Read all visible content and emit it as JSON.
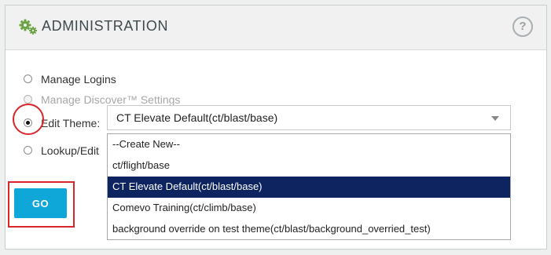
{
  "header": {
    "title": "ADMINISTRATION",
    "icon": "gears-icon",
    "help_label": "?"
  },
  "options": [
    {
      "label": "Manage Logins",
      "checked": false,
      "disabled": false
    },
    {
      "label": "Manage Discover™ Settings",
      "checked": false,
      "disabled": true
    },
    {
      "label": "Edit Theme:",
      "checked": true,
      "disabled": false
    },
    {
      "label": "Lookup/Edit",
      "checked": false,
      "disabled": false
    }
  ],
  "theme_select": {
    "selected": "CT Elevate Default(ct/blast/base)",
    "options": [
      "--Create New--",
      "ct/flight/base",
      "CT Elevate Default(ct/blast/base)",
      "Comevo Training(ct/climb/base)",
      "background override on test theme(ct/blast/background_overried_test)"
    ],
    "highlighted_index": 2
  },
  "go_button_label": "GO",
  "colors": {
    "accent_button": "#0fa6d8",
    "dropdown_selected": "#0d2460",
    "annotation_red": "#d9262b",
    "header_text": "#3f4a4f",
    "gear_icon": "#6aa342"
  }
}
